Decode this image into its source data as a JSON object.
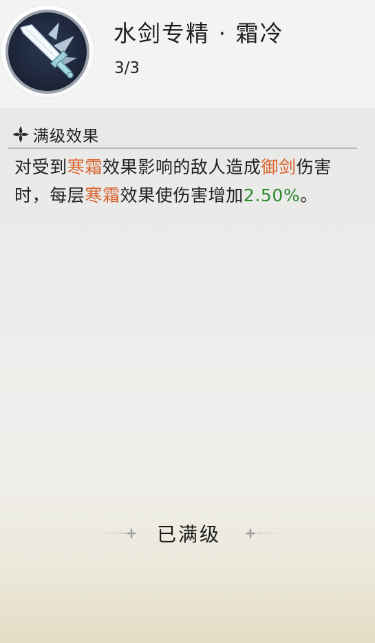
{
  "header": {
    "icon": "ice-sword-icon",
    "title": "水剑专精 · 霜冷",
    "level": "3/3"
  },
  "section": {
    "icon": "four-petal-ornament-icon",
    "title": "满级效果"
  },
  "description": {
    "segments": [
      {
        "text": "对受到",
        "style": "normal"
      },
      {
        "text": "寒霜",
        "style": "orange"
      },
      {
        "text": "效果影响的敌人造成",
        "style": "normal"
      },
      {
        "text": "御剑",
        "style": "orange"
      },
      {
        "text": "伤害时，每层",
        "style": "normal"
      },
      {
        "text": "寒霜",
        "style": "orange"
      },
      {
        "text": "效果使伤害增加",
        "style": "normal"
      },
      {
        "text": "2.50%",
        "style": "green"
      },
      {
        "text": "。",
        "style": "normal"
      }
    ]
  },
  "status": {
    "text": "已满级"
  },
  "colors": {
    "orange": "#d9622b",
    "green": "#2c8a2c"
  }
}
